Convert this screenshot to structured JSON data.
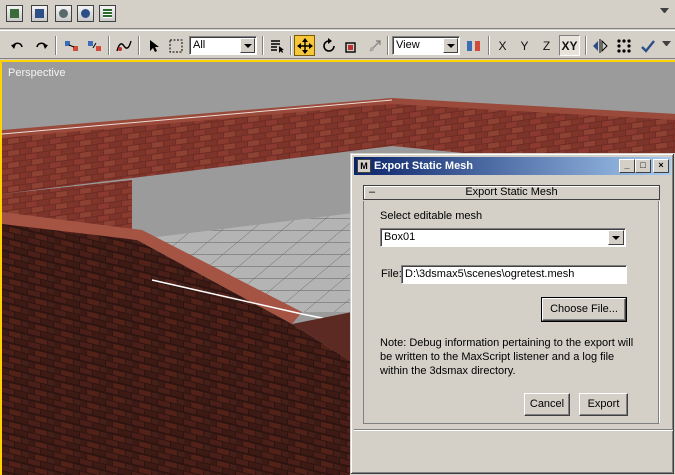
{
  "icon_tabs": [
    "track-view-icon",
    "schematic-view-icon",
    "material-editor-icon",
    "render-scene-icon",
    "listener-icon"
  ],
  "toolbar": {
    "selection_filter": "All",
    "reference_coord": "View",
    "axis_x": "X",
    "axis_y": "Y",
    "axis_z": "Z",
    "axis_xy": "XY"
  },
  "viewport": {
    "label": "Perspective"
  },
  "dialog": {
    "title": "Export Static Mesh",
    "rollout_title": "Export Static Mesh",
    "rollout_toggle": "–",
    "select_label": "Select editable mesh",
    "mesh_value": "Box01",
    "file_label": "File:",
    "file_value": "D:\\3dsmax5\\scenes\\ogretest.mesh",
    "choose_file_label": "Choose File...",
    "note_text": "Note: Debug information pertaining to the export will be written to the MaxScript listener and a log file within the 3dsmax directory.",
    "cancel_label": "Cancel",
    "export_label": "Export",
    "minimize_glyph": "_",
    "maximize_glyph": "□",
    "close_glyph": "×"
  },
  "colors": {
    "viewport_border": "#ffd200",
    "title_gradient_start": "#0a246a",
    "brick": "#8a3a2e",
    "floor": "#b4b4b4"
  }
}
